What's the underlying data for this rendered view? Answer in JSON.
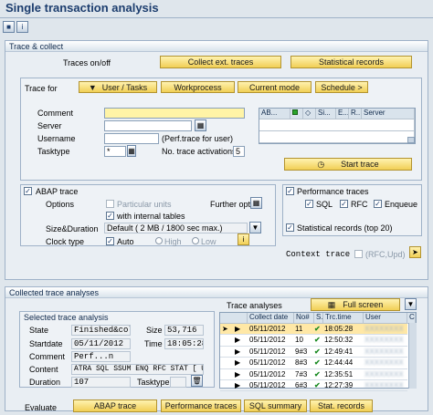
{
  "app": {
    "title": "Single transaction analysis"
  },
  "toolbar": {
    "save_icon": "save-icon",
    "info_icon": "info-icon"
  },
  "trace_collect": {
    "header": "Trace & collect",
    "traces_on_off": "Traces on/off",
    "collect_ext_traces": "Collect ext. traces",
    "statistical_records": "Statistical records",
    "trace_for_label": "Trace for",
    "trace_for_buttons": [
      "User / Tasks",
      "Workprocess",
      "Current mode",
      "Schedule >"
    ],
    "comment_label": "Comment",
    "server_label": "Server",
    "username_label": "Username",
    "username_hint": "(Perf.trace for user)",
    "tasktype_label": "Tasktype",
    "tasktype_value": "*",
    "no_trace_activations_label": "No. trace activations",
    "no_trace_activations_value": "5",
    "server_grid_headers": [
      "AB...",
      "",
      "◇",
      "Si...",
      "E...",
      "R...",
      "Server"
    ],
    "start_trace": "Start trace",
    "abap_trace": {
      "header": "ABAP trace",
      "options": "Options",
      "particular_units": "Particular units",
      "with_internal_tables": "with internal tables",
      "further_opt": "Further opt.",
      "size_duration_label": "Size&Duration",
      "size_duration_value": "Default ( 2 MB / 1800 sec max.)",
      "clock_type_label": "Clock type",
      "auto": "Auto",
      "high": "High",
      "low": "Low"
    },
    "performance_traces": {
      "header": "Performance traces",
      "sql": "SQL",
      "rfc": "RFC",
      "enqueue": "Enqueue",
      "stat_records_top": "Statistical records (top 20)",
      "context_trace": "Context trace",
      "rfc_upd": "(RFC,Upd)"
    }
  },
  "collected": {
    "header": "Collected trace analyses",
    "selected_header": "Selected trace analysis",
    "state_label": "State",
    "state_value": "Finished&col...",
    "size_label": "Size",
    "size_value": "53,716",
    "startdate_label": "Startdate",
    "startdate_value": "05/11/2012",
    "time_label": "Time",
    "time_value": "18:05:28",
    "comment_label": "Comment",
    "comment_value": "Perf...n",
    "content_label": "Content",
    "content_value": "ATRA SQL SSUM ENQ RFC STAT [ U...",
    "duration_label": "Duration",
    "duration_value": "107",
    "tasktype_label": "Tasktype",
    "trace_analyses_label": "Trace analyses",
    "full_screen": "Full screen",
    "table_headers": [
      "",
      "Collect date",
      "No#",
      "S.",
      "Trc.time",
      "User",
      "C"
    ],
    "rows": [
      {
        "date": "05/11/2012",
        "no": "11",
        "time": "18:05:28",
        "user": "XXXXXXXX"
      },
      {
        "date": "05/11/2012",
        "no": "10",
        "time": "12:50:32",
        "user": "XXXXXXXX"
      },
      {
        "date": "05/11/2012",
        "no": "9#3",
        "time": "12:49:41",
        "user": "XXXXXXXX"
      },
      {
        "date": "05/11/2012",
        "no": "8#3",
        "time": "12:44:44",
        "user": "XXXXXXXX"
      },
      {
        "date": "05/11/2012",
        "no": "7#3",
        "time": "12:35:51",
        "user": "XXXXXXXX"
      },
      {
        "date": "05/11/2012",
        "no": "6#3",
        "time": "12:27:39",
        "user": "XXXXXXXX"
      }
    ]
  },
  "evaluate": {
    "label": "Evaluate",
    "buttons": [
      "ABAP trace",
      "Performance traces",
      "SQL summary",
      "Stat. records"
    ]
  },
  "colors": {
    "title": "#1c3d6e",
    "button": "#f1cf55",
    "background": "#dfe6ec"
  }
}
